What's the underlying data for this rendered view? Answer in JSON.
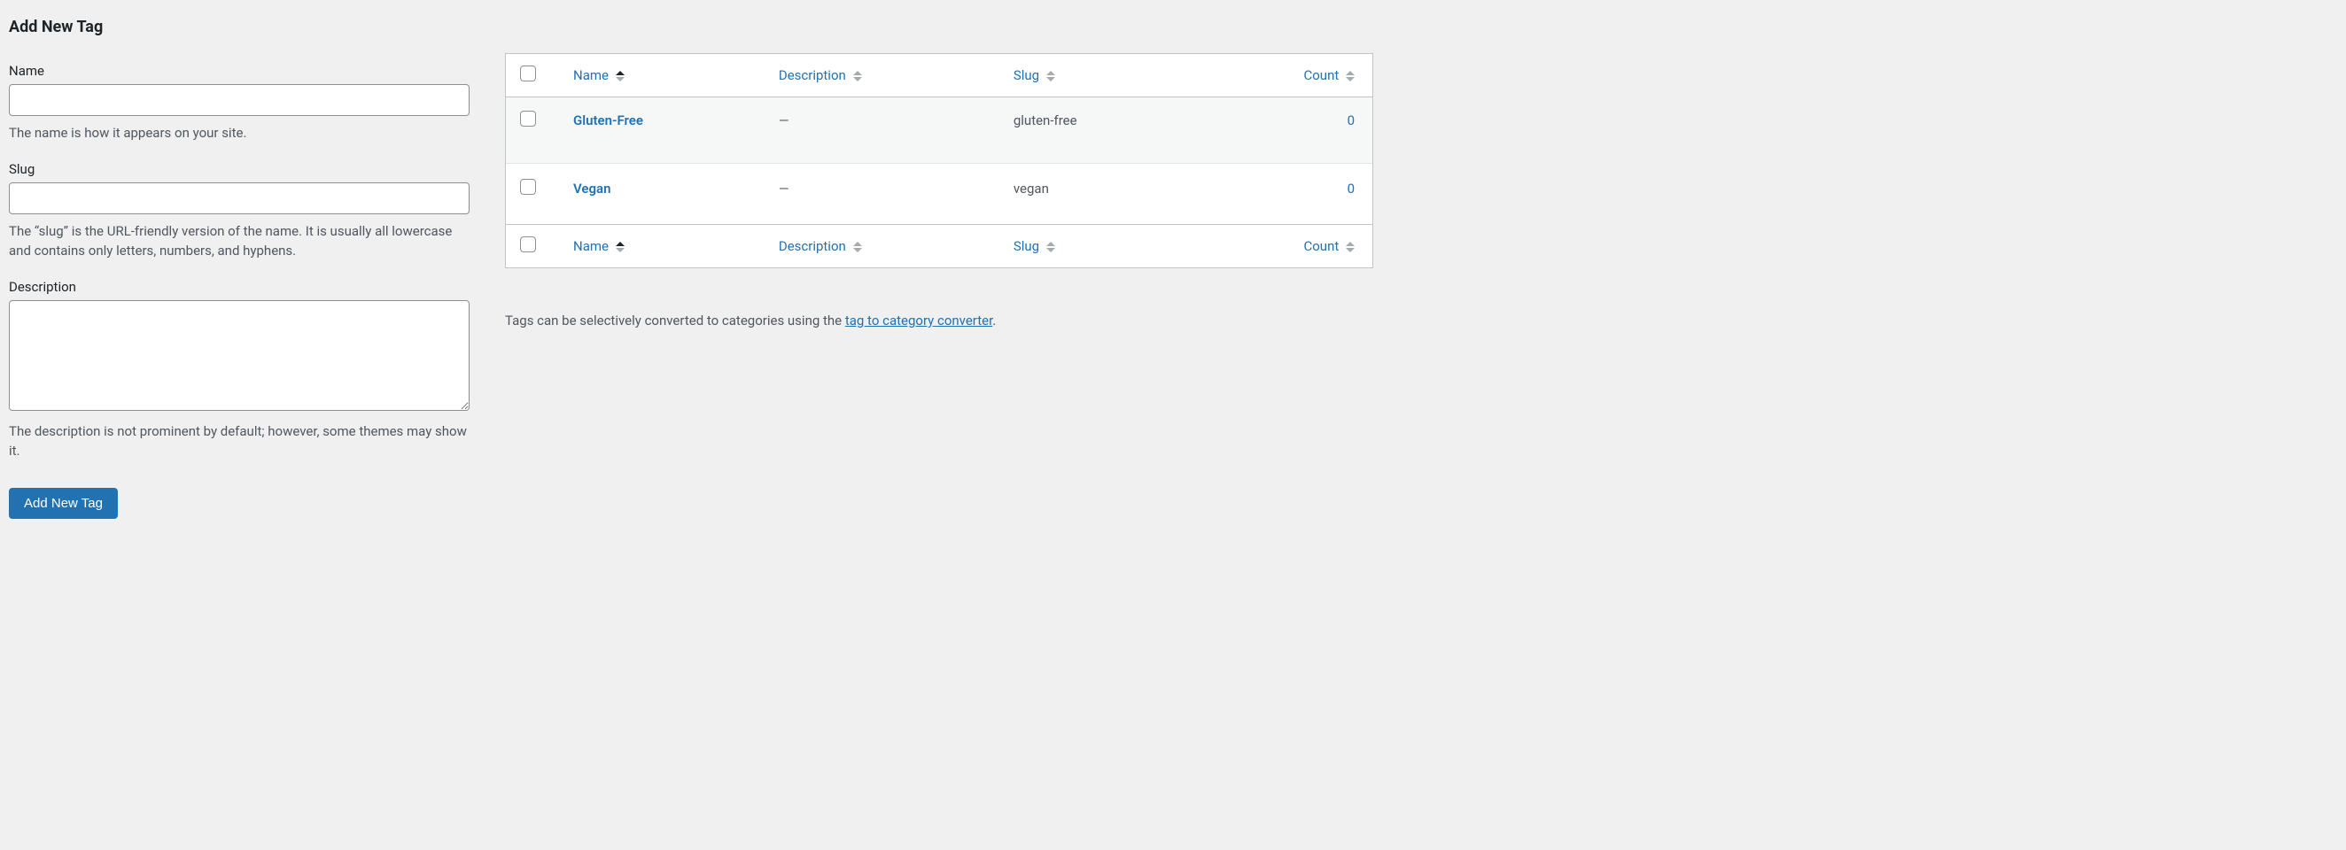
{
  "form": {
    "title": "Add New Tag",
    "name": {
      "label": "Name",
      "value": "",
      "help": "The name is how it appears on your site."
    },
    "slug": {
      "label": "Slug",
      "value": "",
      "help": "The “slug” is the URL-friendly version of the name. It is usually all lowercase and contains only letters, numbers, and hyphens."
    },
    "description": {
      "label": "Description",
      "value": "",
      "help": "The description is not prominent by default; however, some themes may show it."
    },
    "submit_label": "Add New Tag"
  },
  "table": {
    "columns": {
      "name": "Name",
      "description": "Description",
      "slug": "Slug",
      "count": "Count"
    },
    "rows": [
      {
        "name": "Gluten-Free",
        "description": "—",
        "slug": "gluten-free",
        "count": "0"
      },
      {
        "name": "Vegan",
        "description": "—",
        "slug": "vegan",
        "count": "0"
      }
    ]
  },
  "footer_note": {
    "prefix": "Tags can be selectively converted to categories using the ",
    "link_text": "tag to category converter",
    "suffix": "."
  }
}
